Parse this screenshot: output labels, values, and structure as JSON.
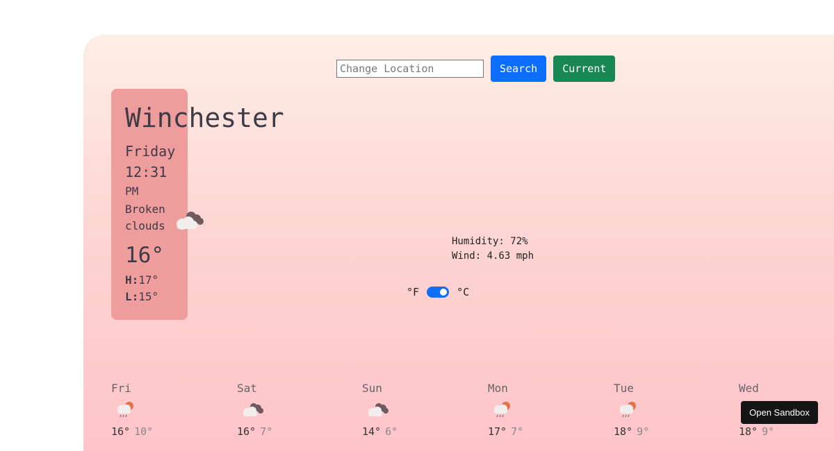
{
  "search": {
    "placeholder": "Change Location",
    "search_label": "Search",
    "current_label": "Current"
  },
  "current": {
    "city": "Winchester",
    "day": "Friday",
    "time": "12:31",
    "ampm": "PM",
    "description": "Broken clouds",
    "icon": "broken-clouds-icon",
    "temp": "16°",
    "high_label": "H:",
    "high": "17°",
    "low_label": "L:",
    "low": "15°"
  },
  "details": {
    "humidity": "Humidity: 72%",
    "wind": "Wind: 4.63 mph"
  },
  "units": {
    "fahrenheit": "°F",
    "celsius": "°C",
    "selected": "°C"
  },
  "forecast": [
    {
      "day": "Fri",
      "icon": "rain-icon",
      "high": "16°",
      "low": "10°"
    },
    {
      "day": "Sat",
      "icon": "broken-clouds-icon",
      "high": "16°",
      "low": "7°"
    },
    {
      "day": "Sun",
      "icon": "broken-clouds-icon",
      "high": "14°",
      "low": "6°"
    },
    {
      "day": "Mon",
      "icon": "rain-icon",
      "high": "17°",
      "low": "7°"
    },
    {
      "day": "Tue",
      "icon": "rain-icon",
      "high": "18°",
      "low": "9°"
    },
    {
      "day": "Wed",
      "icon": "rain-icon",
      "high": "18°",
      "low": "9°"
    }
  ],
  "sandbox": {
    "label": "Open Sandbox"
  },
  "colors": {
    "card": "#ee9c9c",
    "search_button": "#0d6efd",
    "current_button": "#198754",
    "toggle": "#0d6efd"
  }
}
